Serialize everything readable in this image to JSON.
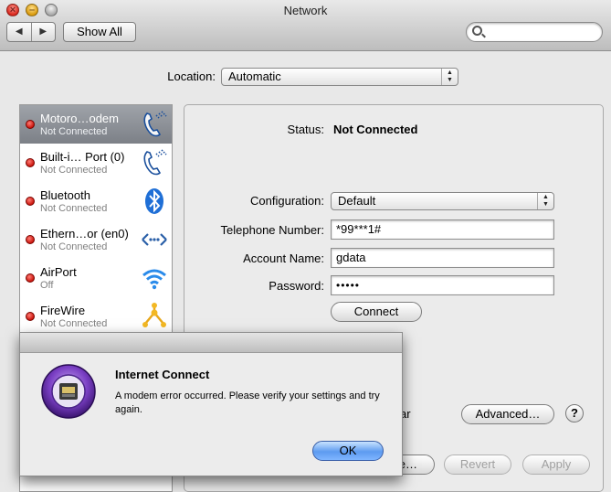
{
  "window": {
    "title": "Network",
    "nav_back": "◀",
    "nav_forward": "▶",
    "show_all": "Show All",
    "search_placeholder": ""
  },
  "location": {
    "label": "Location:",
    "value": "Automatic"
  },
  "services": [
    {
      "name": "Motoro…odem",
      "status": "Not Connected",
      "icon": "modem-phone-icon",
      "selected": true,
      "status_color": "#d8150c"
    },
    {
      "name": "Built-i… Port (0)",
      "status": "Not Connected",
      "icon": "modem-phone-icon",
      "selected": false,
      "status_color": "#d8150c"
    },
    {
      "name": "Bluetooth",
      "status": "Not Connected",
      "icon": "bluetooth-icon",
      "selected": false,
      "status_color": "#d8150c"
    },
    {
      "name": "Ethern…or (en0)",
      "status": "Not Connected",
      "icon": "ethernet-arrows-icon",
      "selected": false,
      "status_color": "#d8150c"
    },
    {
      "name": "AirPort",
      "status": "Off",
      "icon": "wifi-icon",
      "selected": false,
      "status_color": "#d8150c"
    },
    {
      "name": "FireWire",
      "status": "Not Connected",
      "icon": "firewire-icon",
      "selected": false,
      "status_color": "#d8150c"
    }
  ],
  "detail": {
    "status_label": "Status:",
    "status_value": "Not Connected",
    "configuration_label": "Configuration:",
    "configuration_value": "Default",
    "telephone_label": "Telephone Number:",
    "telephone_value": "*99***1#",
    "account_label": "Account Name:",
    "account_value": "gdata",
    "password_label": "Password:",
    "password_value": "•••••",
    "connect_button": "Connect",
    "partial_text": "ar",
    "advanced_button": "Advanced…",
    "help_button": "?",
    "partial_button": "e…",
    "revert_button": "Revert",
    "apply_button": "Apply"
  },
  "alert": {
    "heading": "Internet Connect",
    "message": "A modem error occurred. Please verify your settings and try again.",
    "ok_button": "OK",
    "icon": "internet-connect-icon"
  },
  "colors": {
    "selection": "#868a91",
    "default_button": "#5d9bf0",
    "status_dot": "#d8150c"
  }
}
